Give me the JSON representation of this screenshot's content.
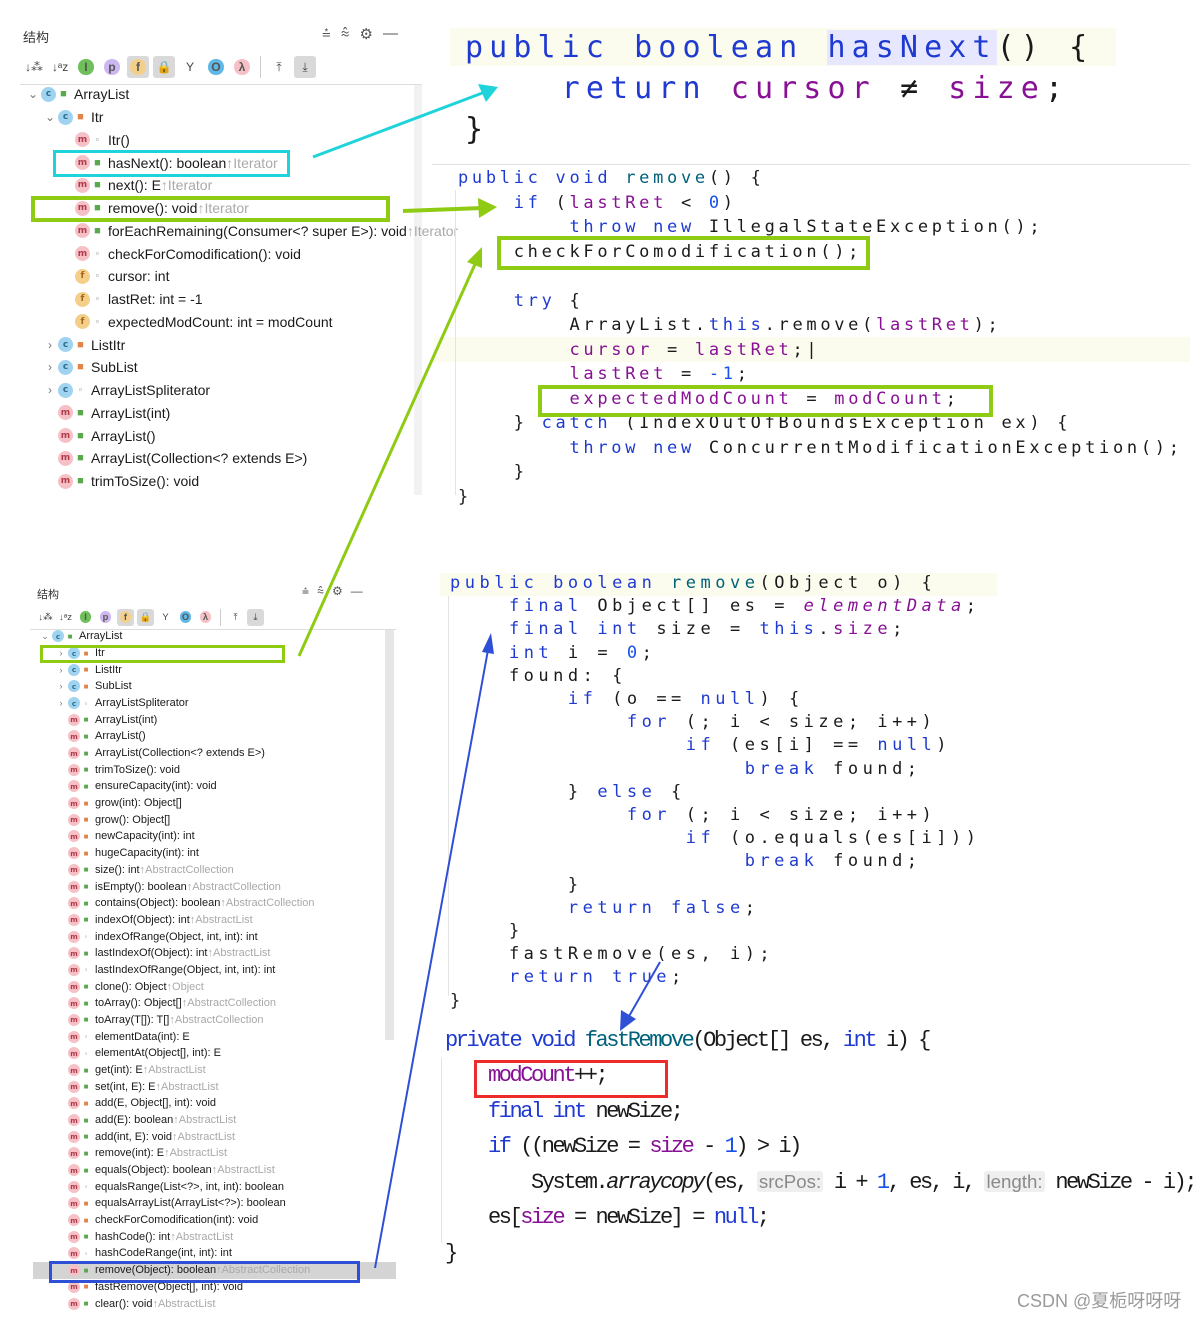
{
  "structure_top": {
    "title": "结构",
    "header_icons": [
      "expand-all-icon",
      "collapse-all-icon",
      "gear-icon",
      "minimize-icon"
    ],
    "toolbar": [
      {
        "icon": "sort-by-visibility-icon",
        "glyph": "↓⁂",
        "on": false
      },
      {
        "icon": "sort-alphabetically-icon",
        "glyph": "↓ᵃz",
        "on": false
      },
      {
        "icon": "show-inherited-icon",
        "glyph": "I",
        "on": false,
        "circle": "#6fbf5a"
      },
      {
        "icon": "show-properties-icon",
        "glyph": "p",
        "on": false,
        "circle": "#cdb7f0"
      },
      {
        "icon": "show-fields-icon",
        "glyph": "f",
        "on": true,
        "circle": "#f4cf8a"
      },
      {
        "icon": "show-non-public-icon",
        "glyph": "🔒",
        "on": true
      },
      {
        "icon": "show-anonymous-icon",
        "glyph": "Y",
        "on": false
      },
      {
        "icon": "show-interfaces-icon",
        "glyph": "O",
        "on": false,
        "circle": "#5fb8e6"
      },
      {
        "icon": "show-lambdas-icon",
        "glyph": "λ",
        "on": false,
        "circle": "#f6c1c6"
      },
      {
        "sep": true
      },
      {
        "icon": "autoscroll-to-source-icon",
        "glyph": "⤒",
        "on": false
      },
      {
        "icon": "autoscroll-from-source-icon",
        "glyph": "⤓",
        "on": true
      }
    ],
    "items": [
      {
        "type": "c",
        "vis": "public",
        "level": 0,
        "expand": "open",
        "name": "ArrayList",
        "inherit": ""
      },
      {
        "type": "c",
        "vis": "private",
        "level": 1,
        "expand": "open",
        "name": "Itr",
        "inherit": ""
      },
      {
        "type": "m",
        "vis": "package",
        "level": 2,
        "name": "Itr()",
        "inherit": ""
      },
      {
        "type": "m",
        "vis": "public",
        "level": 2,
        "name": "hasNext(): boolean",
        "inherit": "↑Iterator"
      },
      {
        "type": "m",
        "vis": "public",
        "level": 2,
        "name": "next(): E",
        "inherit": "↑Iterator"
      },
      {
        "type": "m",
        "vis": "public",
        "level": 2,
        "name": "remove(): void",
        "inherit": "↑Iterator"
      },
      {
        "type": "m",
        "vis": "public",
        "level": 2,
        "name": "forEachRemaining(Consumer<? super E>): void",
        "inherit": "↑Iterator"
      },
      {
        "type": "m",
        "vis": "package",
        "level": 2,
        "name": "checkForComodification(): void",
        "inherit": ""
      },
      {
        "type": "f",
        "vis": "package",
        "level": 2,
        "name": "cursor: int",
        "inherit": ""
      },
      {
        "type": "f",
        "vis": "package",
        "level": 2,
        "name": "lastRet: int = -1",
        "inherit": ""
      },
      {
        "type": "f",
        "vis": "package",
        "level": 2,
        "name": "expectedModCount: int = modCount",
        "inherit": ""
      },
      {
        "type": "c",
        "vis": "private",
        "level": 1,
        "expand": "closed",
        "name": "ListItr",
        "inherit": ""
      },
      {
        "type": "c",
        "vis": "private",
        "level": 1,
        "expand": "closed",
        "name": "SubList",
        "inherit": ""
      },
      {
        "type": "c",
        "vis": "package",
        "level": 1,
        "expand": "closed",
        "name": "ArrayListSpliterator",
        "inherit": ""
      },
      {
        "type": "m",
        "vis": "public",
        "level": 1,
        "name": "ArrayList(int)",
        "inherit": ""
      },
      {
        "type": "m",
        "vis": "public",
        "level": 1,
        "name": "ArrayList()",
        "inherit": ""
      },
      {
        "type": "m",
        "vis": "public",
        "level": 1,
        "name": "ArrayList(Collection<? extends E>)",
        "inherit": ""
      },
      {
        "type": "m",
        "vis": "public",
        "level": 1,
        "name": "trimToSize(): void",
        "inherit": ""
      }
    ]
  },
  "structure_bottom": {
    "title": "结构",
    "items": [
      {
        "type": "c",
        "vis": "public",
        "level": 0,
        "expand": "open",
        "name": "ArrayList",
        "inherit": ""
      },
      {
        "type": "c",
        "vis": "private",
        "level": 1,
        "expand": "closed",
        "name": "Itr",
        "inherit": ""
      },
      {
        "type": "c",
        "vis": "private",
        "level": 1,
        "expand": "closed",
        "name": "ListItr",
        "inherit": ""
      },
      {
        "type": "c",
        "vis": "private",
        "level": 1,
        "expand": "closed",
        "name": "SubList",
        "inherit": ""
      },
      {
        "type": "c",
        "vis": "package",
        "level": 1,
        "expand": "closed",
        "name": "ArrayListSpliterator",
        "inherit": ""
      },
      {
        "type": "m",
        "vis": "public",
        "level": 1,
        "name": "ArrayList(int)",
        "inherit": ""
      },
      {
        "type": "m",
        "vis": "public",
        "level": 1,
        "name": "ArrayList()",
        "inherit": ""
      },
      {
        "type": "m",
        "vis": "public",
        "level": 1,
        "name": "ArrayList(Collection<? extends E>)",
        "inherit": ""
      },
      {
        "type": "m",
        "vis": "public",
        "level": 1,
        "name": "trimToSize(): void",
        "inherit": ""
      },
      {
        "type": "m",
        "vis": "public",
        "level": 1,
        "name": "ensureCapacity(int): void",
        "inherit": ""
      },
      {
        "type": "m",
        "vis": "private",
        "level": 1,
        "name": "grow(int): Object[]",
        "inherit": ""
      },
      {
        "type": "m",
        "vis": "private",
        "level": 1,
        "name": "grow(): Object[]",
        "inherit": ""
      },
      {
        "type": "m",
        "vis": "private",
        "level": 1,
        "name": "newCapacity(int): int",
        "inherit": ""
      },
      {
        "type": "m",
        "vis": "private",
        "level": 1,
        "name": "hugeCapacity(int): int",
        "inherit": ""
      },
      {
        "type": "m",
        "vis": "public",
        "level": 1,
        "name": "size(): int",
        "inherit": "↑AbstractCollection"
      },
      {
        "type": "m",
        "vis": "public",
        "level": 1,
        "name": "isEmpty(): boolean",
        "inherit": "↑AbstractCollection"
      },
      {
        "type": "m",
        "vis": "public",
        "level": 1,
        "name": "contains(Object): boolean",
        "inherit": "↑AbstractCollection"
      },
      {
        "type": "m",
        "vis": "public",
        "level": 1,
        "name": "indexOf(Object): int",
        "inherit": "↑AbstractList"
      },
      {
        "type": "m",
        "vis": "package",
        "level": 1,
        "name": "indexOfRange(Object, int, int): int",
        "inherit": ""
      },
      {
        "type": "m",
        "vis": "public",
        "level": 1,
        "name": "lastIndexOf(Object): int",
        "inherit": "↑AbstractList"
      },
      {
        "type": "m",
        "vis": "package",
        "level": 1,
        "name": "lastIndexOfRange(Object, int, int): int",
        "inherit": ""
      },
      {
        "type": "m",
        "vis": "public",
        "level": 1,
        "name": "clone(): Object",
        "inherit": "↑Object"
      },
      {
        "type": "m",
        "vis": "public",
        "level": 1,
        "name": "toArray(): Object[]",
        "inherit": "↑AbstractCollection"
      },
      {
        "type": "m",
        "vis": "public",
        "level": 1,
        "name": "toArray(T[]): T[]",
        "inherit": "↑AbstractCollection"
      },
      {
        "type": "m",
        "vis": "package",
        "level": 1,
        "name": "elementData(int): E",
        "inherit": ""
      },
      {
        "type": "m",
        "vis": "package",
        "level": 1,
        "name": "elementAt(Object[], int): E",
        "inherit": ""
      },
      {
        "type": "m",
        "vis": "public",
        "level": 1,
        "name": "get(int): E",
        "inherit": "↑AbstractList"
      },
      {
        "type": "m",
        "vis": "public",
        "level": 1,
        "name": "set(int, E): E",
        "inherit": "↑AbstractList"
      },
      {
        "type": "m",
        "vis": "private",
        "level": 1,
        "name": "add(E, Object[], int): void",
        "inherit": ""
      },
      {
        "type": "m",
        "vis": "public",
        "level": 1,
        "name": "add(E): boolean",
        "inherit": "↑AbstractList"
      },
      {
        "type": "m",
        "vis": "public",
        "level": 1,
        "name": "add(int, E): void",
        "inherit": "↑AbstractList"
      },
      {
        "type": "m",
        "vis": "public",
        "level": 1,
        "name": "remove(int): E",
        "inherit": "↑AbstractList"
      },
      {
        "type": "m",
        "vis": "public",
        "level": 1,
        "name": "equals(Object): boolean",
        "inherit": "↑AbstractList"
      },
      {
        "type": "m",
        "vis": "package",
        "level": 1,
        "name": "equalsRange(List<?>, int, int): boolean",
        "inherit": ""
      },
      {
        "type": "m",
        "vis": "private",
        "level": 1,
        "name": "equalsArrayList(ArrayList<?>): boolean",
        "inherit": ""
      },
      {
        "type": "m",
        "vis": "private",
        "level": 1,
        "name": "checkForComodification(int): void",
        "inherit": ""
      },
      {
        "type": "m",
        "vis": "public",
        "level": 1,
        "name": "hashCode(): int",
        "inherit": "↑AbstractList"
      },
      {
        "type": "m",
        "vis": "package",
        "level": 1,
        "name": "hashCodeRange(int, int): int",
        "inherit": ""
      },
      {
        "type": "m",
        "vis": "public",
        "level": 1,
        "name": "remove(Object): boolean",
        "inherit": "↑AbstractCollection",
        "selected": true
      },
      {
        "type": "m",
        "vis": "private",
        "level": 1,
        "name": "fastRemove(Object[], int): void",
        "inherit": ""
      },
      {
        "type": "m",
        "vis": "public",
        "level": 1,
        "name": "clear(): void",
        "inherit": "↑AbstractList"
      }
    ]
  },
  "code_hasnext": [
    [
      [
        "k",
        "public "
      ],
      [
        "k",
        "boolean "
      ],
      [
        "k hl",
        "hasNext"
      ],
      [
        "p",
        "() {"
      ]
    ],
    [
      [
        "p",
        "    "
      ],
      [
        "k",
        "return "
      ],
      [
        "f",
        "cursor"
      ],
      [
        "p",
        " ≠ "
      ],
      [
        "f",
        "size"
      ],
      [
        "p",
        ";"
      ]
    ],
    [
      [
        "p",
        "}"
      ]
    ]
  ],
  "code_itr_remove": [
    [
      [
        "k",
        "public "
      ],
      [
        "k",
        "void "
      ],
      [
        "m",
        "remove"
      ],
      [
        "p",
        "() {"
      ]
    ],
    [
      [
        "p",
        "    "
      ],
      [
        "k",
        "if "
      ],
      [
        "p",
        "("
      ],
      [
        "f",
        "lastRet"
      ],
      [
        "p",
        " < "
      ],
      [
        "n",
        "0"
      ],
      [
        "p",
        ")"
      ]
    ],
    [
      [
        "p",
        "        "
      ],
      [
        "k",
        "throw new "
      ],
      [
        "p",
        "IllegalStateException();"
      ]
    ],
    [
      [
        "p",
        "    checkForComodification();"
      ]
    ],
    [
      [
        "p",
        " "
      ]
    ],
    [
      [
        "p",
        "    "
      ],
      [
        "k",
        "try "
      ],
      [
        "p",
        "{"
      ]
    ],
    [
      [
        "p",
        "        ArrayList."
      ],
      [
        "k",
        "this"
      ],
      [
        "p",
        ".remove("
      ],
      [
        "f",
        "lastRet"
      ],
      [
        "p",
        ");"
      ]
    ],
    [
      [
        "p",
        "        "
      ],
      [
        "f",
        "cursor"
      ],
      [
        "p",
        " = "
      ],
      [
        "f",
        "lastRet"
      ],
      [
        "p",
        ";|"
      ]
    ],
    [
      [
        "p",
        "        "
      ],
      [
        "f",
        "lastRet"
      ],
      [
        "p",
        " = "
      ],
      [
        "n",
        "-1"
      ],
      [
        "p",
        ";"
      ]
    ],
    [
      [
        "p",
        "        "
      ],
      [
        "f",
        "expectedModCount"
      ],
      [
        "p",
        " = "
      ],
      [
        "f",
        "modCount"
      ],
      [
        "p",
        ";"
      ]
    ],
    [
      [
        "p",
        "    } "
      ],
      [
        "k",
        "catch "
      ],
      [
        "p",
        "(IndexOutOfBoundsException ex) {"
      ]
    ],
    [
      [
        "p",
        "        "
      ],
      [
        "k",
        "throw new "
      ],
      [
        "p",
        "ConcurrentModificationException();"
      ]
    ],
    [
      [
        "p",
        "    }"
      ]
    ],
    [
      [
        "p",
        "}"
      ]
    ]
  ],
  "code_remove_object": [
    [
      [
        "k",
        "public "
      ],
      [
        "k",
        "boolean "
      ],
      [
        "m",
        "remove"
      ],
      [
        "p",
        "(Object o) {"
      ]
    ],
    [
      [
        "p",
        "    "
      ],
      [
        "k",
        "final "
      ],
      [
        "p",
        "Object[] es = "
      ],
      [
        "fi",
        "elementData"
      ],
      [
        "p",
        ";"
      ]
    ],
    [
      [
        "p",
        "    "
      ],
      [
        "k",
        "final int "
      ],
      [
        "p",
        "size = "
      ],
      [
        "k",
        "this"
      ],
      [
        "p",
        "."
      ],
      [
        "f",
        "size"
      ],
      [
        "p",
        ";"
      ]
    ],
    [
      [
        "p",
        "    "
      ],
      [
        "k",
        "int "
      ],
      [
        "p",
        "i = "
      ],
      [
        "n",
        "0"
      ],
      [
        "p",
        ";"
      ]
    ],
    [
      [
        "p",
        "    found: {"
      ]
    ],
    [
      [
        "p",
        "        "
      ],
      [
        "k",
        "if "
      ],
      [
        "p",
        "(o == "
      ],
      [
        "k",
        "null"
      ],
      [
        "p",
        ") {"
      ]
    ],
    [
      [
        "p",
        "            "
      ],
      [
        "k",
        "for "
      ],
      [
        "p",
        "(; i < size; i++)"
      ]
    ],
    [
      [
        "p",
        "                "
      ],
      [
        "k",
        "if "
      ],
      [
        "p",
        "(es[i] == "
      ],
      [
        "k",
        "null"
      ],
      [
        "p",
        ")"
      ]
    ],
    [
      [
        "p",
        "                    "
      ],
      [
        "k",
        "break "
      ],
      [
        "p",
        "found;"
      ]
    ],
    [
      [
        "p",
        "        } "
      ],
      [
        "k",
        "else "
      ],
      [
        "p",
        "{"
      ]
    ],
    [
      [
        "p",
        "            "
      ],
      [
        "k",
        "for "
      ],
      [
        "p",
        "(; i < size; i++)"
      ]
    ],
    [
      [
        "p",
        "                "
      ],
      [
        "k",
        "if "
      ],
      [
        "p",
        "(o.equals(es[i]))"
      ]
    ],
    [
      [
        "p",
        "                    "
      ],
      [
        "k",
        "break "
      ],
      [
        "p",
        "found;"
      ]
    ],
    [
      [
        "p",
        "        }"
      ]
    ],
    [
      [
        "p",
        "        "
      ],
      [
        "k",
        "return false"
      ],
      [
        "p",
        ";"
      ]
    ],
    [
      [
        "p",
        "    }"
      ]
    ],
    [
      [
        "p",
        "    fastRemove(es, i);"
      ]
    ],
    [
      [
        "p",
        "    "
      ],
      [
        "k",
        "return true"
      ],
      [
        "p",
        ";"
      ]
    ],
    [
      [
        "p",
        "}"
      ]
    ]
  ],
  "code_fast_remove": [
    [
      [
        "k",
        "private "
      ],
      [
        "k",
        "void "
      ],
      [
        "m",
        "fastRemove"
      ],
      [
        "p",
        "(Object[] es, "
      ],
      [
        "k",
        "int "
      ],
      [
        "p",
        "i) {"
      ]
    ],
    [
      [
        "p",
        "    "
      ],
      [
        "f",
        "modCount"
      ],
      [
        "p",
        "++;"
      ]
    ],
    [
      [
        "p",
        "    "
      ],
      [
        "k",
        "final "
      ],
      [
        "k",
        "int "
      ],
      [
        "p",
        "newSize;"
      ]
    ],
    [
      [
        "p",
        "    "
      ],
      [
        "k",
        "if "
      ],
      [
        "p",
        "((newSize = "
      ],
      [
        "f",
        "size"
      ],
      [
        "p",
        " - "
      ],
      [
        "n",
        "1"
      ],
      [
        "p",
        ") > i)"
      ]
    ],
    [
      [
        "p",
        "        System."
      ],
      [
        "p it",
        "arraycopy"
      ],
      [
        "p",
        "(es, "
      ],
      [
        "hint",
        "srcPos:"
      ],
      [
        "p",
        " i + "
      ],
      [
        "n",
        "1"
      ],
      [
        "p",
        ", es, i, "
      ],
      [
        "hint",
        "length:"
      ],
      [
        "p",
        " newSize - i);"
      ]
    ],
    [
      [
        "p",
        "    es["
      ],
      [
        "f",
        "size"
      ],
      [
        "p",
        " = newSize] = "
      ],
      [
        "k",
        "null"
      ],
      [
        "p",
        ";"
      ]
    ],
    [
      [
        "p",
        "}"
      ]
    ]
  ],
  "annotation_colors": {
    "cyan": "#1fd3da",
    "green": "#8fcb13",
    "blue": "#2e4fd6",
    "red": "#ee2b2b"
  },
  "watermark": "CSDN @夏栀呀呀呀"
}
